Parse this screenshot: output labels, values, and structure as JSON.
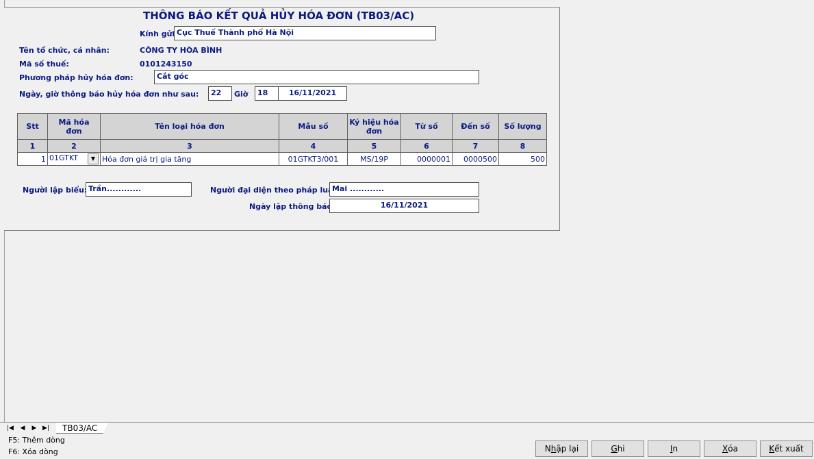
{
  "form": {
    "title": "THÔNG BÁO KẾT QUẢ HỦY HÓA ĐƠN (TB03/AC)",
    "kinh_gui_label": "Kính gửi:",
    "kinh_gui_value": "Cục Thuế Thành phố Hà Nội",
    "org_label": "Tên tổ chức, cá nhân:",
    "org_value": "CÔNG TY HÒA BÌNH",
    "tax_label": "Mã số thuế:",
    "tax_value": "0101243150",
    "method_label": "Phương pháp hủy hóa đơn:",
    "method_value": "Cắt góc",
    "datetime_label": "Ngày, giờ thông báo hủy hóa đơn như sau:",
    "hour_value": "22",
    "gio_label": "Giờ",
    "minute_value": "18",
    "date_value": "16/11/2021"
  },
  "table": {
    "headers": [
      "Stt",
      "Mã hóa đơn",
      "Tên loại hóa đơn",
      "Mẫu số",
      "Ký hiệu hóa đơn",
      "Từ số",
      "Đến số",
      "Số lượng"
    ],
    "numbers": [
      "1",
      "2",
      "3",
      "4",
      "5",
      "6",
      "7",
      "8"
    ],
    "rows": [
      [
        "1",
        "01GTKT",
        "Hóa đơn giá trị gia tăng",
        "01GTKT3/001",
        "MS/19P",
        "0000001",
        "0000500",
        "500"
      ]
    ]
  },
  "footer": {
    "preparer_label": "Người lập biểu:",
    "preparer_value": "Trần............",
    "rep_label": "Người đại diện theo pháp luật:",
    "rep_value": "Mai ............",
    "report_date_label": "Ngày lập thông báo:",
    "report_date_value": "16/11/2021"
  },
  "tabs": {
    "sheet": "TB03/AC"
  },
  "hints": {
    "f5": "F5: Thêm dòng",
    "f6": "F6: Xóa dòng"
  },
  "buttons": {
    "reset": {
      "pre": "N",
      "ul": "h",
      "post": "ập lại"
    },
    "save": {
      "pre": "",
      "ul": "G",
      "post": "hi"
    },
    "print": {
      "pre": "",
      "ul": "I",
      "post": "n"
    },
    "delete": {
      "pre": "",
      "ul": "X",
      "post": "óa"
    },
    "export": {
      "pre": "",
      "ul": "K",
      "post": "ết xuất"
    }
  },
  "icons": {
    "first": "first-page-icon",
    "prev": "prev-page-icon",
    "next": "next-page-icon",
    "last": "last-page-icon",
    "dropdown": "chevron-down-icon"
  }
}
